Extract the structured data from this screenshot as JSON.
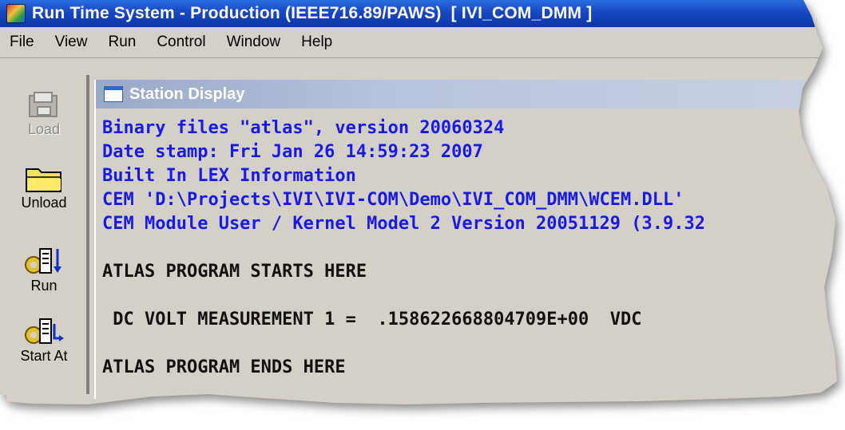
{
  "window": {
    "title": "Run Time System - Production (IEEE716.89/PAWS)  [ IVI_COM_DMM ]"
  },
  "menu": {
    "items": [
      "File",
      "View",
      "Run",
      "Control",
      "Window",
      "Help"
    ]
  },
  "toolbar": {
    "load_label": "Load",
    "unload_label": "Unload",
    "run_label": "Run",
    "start_at_label": "Start At"
  },
  "station_display": {
    "title": "Station Display",
    "lines": [
      {
        "text": "Binary files \"atlas\", version 20060324",
        "color": "blue"
      },
      {
        "text": "Date stamp: Fri Jan 26 14:59:23 2007",
        "color": "blue"
      },
      {
        "text": "Built In LEX Information",
        "color": "blue"
      },
      {
        "text": "CEM 'D:\\Projects\\IVI\\IVI-COM\\Demo\\IVI_COM_DMM\\WCEM.DLL'",
        "color": "blue"
      },
      {
        "text": "CEM Module User / Kernel Model 2 Version 20051129 (3.9.32",
        "color": "blue"
      },
      {
        "text": "",
        "color": "black"
      },
      {
        "text": "ATLAS PROGRAM STARTS HERE",
        "color": "black"
      },
      {
        "text": "",
        "color": "black"
      },
      {
        "text": " DC VOLT MEASUREMENT 1 =  .158622668804709E+00  VDC",
        "color": "black"
      },
      {
        "text": "",
        "color": "black"
      },
      {
        "text": "ATLAS PROGRAM ENDS HERE",
        "color": "black"
      }
    ]
  },
  "colors": {
    "title_bar": "#1648c2",
    "console_info": "#1a1ae6",
    "console_output": "#111111",
    "window_face": "#d4d0c8"
  }
}
